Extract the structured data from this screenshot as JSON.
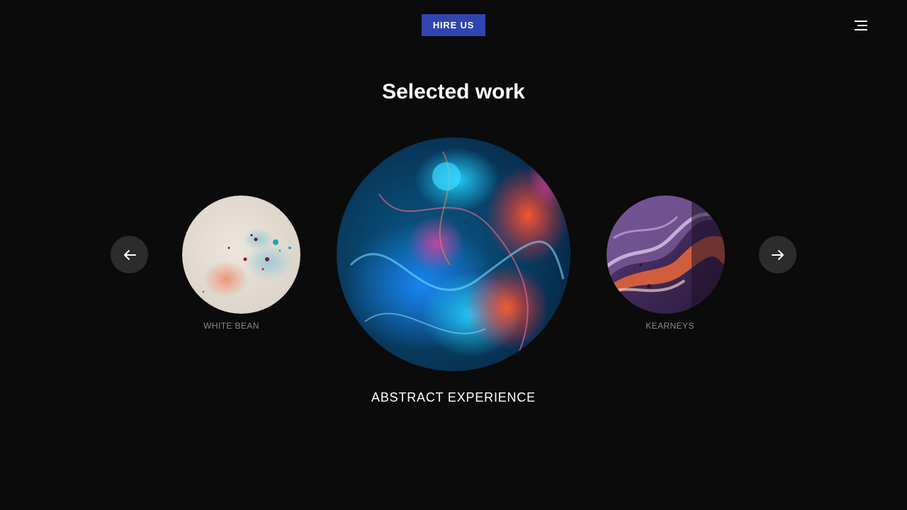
{
  "header": {
    "hire_label": "HIRE US",
    "menu_icon": "hamburger-menu-icon",
    "accent_color": "#3045b0"
  },
  "section": {
    "title": "Selected work"
  },
  "carousel": {
    "prev_icon": "arrow-left-icon",
    "next_icon": "arrow-right-icon",
    "items": [
      {
        "label": "WHITE BEAN",
        "position": "left"
      },
      {
        "label": "ABSTRACT EXPERIENCE",
        "position": "center"
      },
      {
        "label": "KEARNEYS",
        "position": "right"
      }
    ]
  }
}
